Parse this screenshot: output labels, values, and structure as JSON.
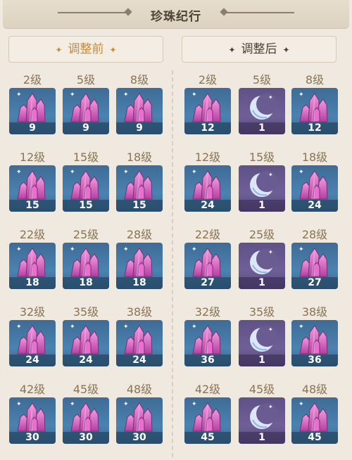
{
  "title": "珍珠纪行",
  "colors": {
    "accent_before": "#c98a3d",
    "text": "#4b4134",
    "level": "#8a7452"
  },
  "panels": {
    "before": {
      "label": "调整前",
      "star_left": "✦",
      "star_right": "✦"
    },
    "after": {
      "label": "调整后",
      "star_left": "✦",
      "star_right": "✦"
    }
  },
  "before": [
    {
      "level": "2级",
      "item": "crystal-icon",
      "qty": "9"
    },
    {
      "level": "5级",
      "item": "crystal-icon",
      "qty": "9"
    },
    {
      "level": "8级",
      "item": "crystal-icon",
      "qty": "9"
    },
    {
      "level": "12级",
      "item": "crystal-icon",
      "qty": "15"
    },
    {
      "level": "15级",
      "item": "crystal-icon",
      "qty": "15"
    },
    {
      "level": "18级",
      "item": "crystal-icon",
      "qty": "15"
    },
    {
      "level": "22级",
      "item": "crystal-icon",
      "qty": "18"
    },
    {
      "level": "25级",
      "item": "crystal-icon",
      "qty": "18"
    },
    {
      "level": "28级",
      "item": "crystal-icon",
      "qty": "18"
    },
    {
      "level": "32级",
      "item": "crystal-icon",
      "qty": "24"
    },
    {
      "level": "35级",
      "item": "crystal-icon",
      "qty": "24"
    },
    {
      "level": "38级",
      "item": "crystal-icon",
      "qty": "24"
    },
    {
      "level": "42级",
      "item": "crystal-icon",
      "qty": "30"
    },
    {
      "level": "45级",
      "item": "crystal-icon",
      "qty": "30"
    },
    {
      "level": "48级",
      "item": "crystal-icon",
      "qty": "30"
    }
  ],
  "after": [
    {
      "level": "2级",
      "item": "crystal-icon",
      "qty": "12"
    },
    {
      "level": "5级",
      "item": "moon-icon",
      "qty": "1"
    },
    {
      "level": "8级",
      "item": "crystal-icon",
      "qty": "12"
    },
    {
      "level": "12级",
      "item": "crystal-icon",
      "qty": "24"
    },
    {
      "level": "15级",
      "item": "moon-icon",
      "qty": "1"
    },
    {
      "level": "18级",
      "item": "crystal-icon",
      "qty": "24"
    },
    {
      "level": "22级",
      "item": "crystal-icon",
      "qty": "27"
    },
    {
      "level": "25级",
      "item": "moon-icon",
      "qty": "1"
    },
    {
      "level": "28级",
      "item": "crystal-icon",
      "qty": "27"
    },
    {
      "level": "32级",
      "item": "crystal-icon",
      "qty": "36"
    },
    {
      "level": "35级",
      "item": "moon-icon",
      "qty": "1"
    },
    {
      "level": "38级",
      "item": "crystal-icon",
      "qty": "36"
    },
    {
      "level": "42级",
      "item": "crystal-icon",
      "qty": "45"
    },
    {
      "level": "45级",
      "item": "moon-icon",
      "qty": "1"
    },
    {
      "level": "48级",
      "item": "crystal-icon",
      "qty": "45"
    }
  ]
}
